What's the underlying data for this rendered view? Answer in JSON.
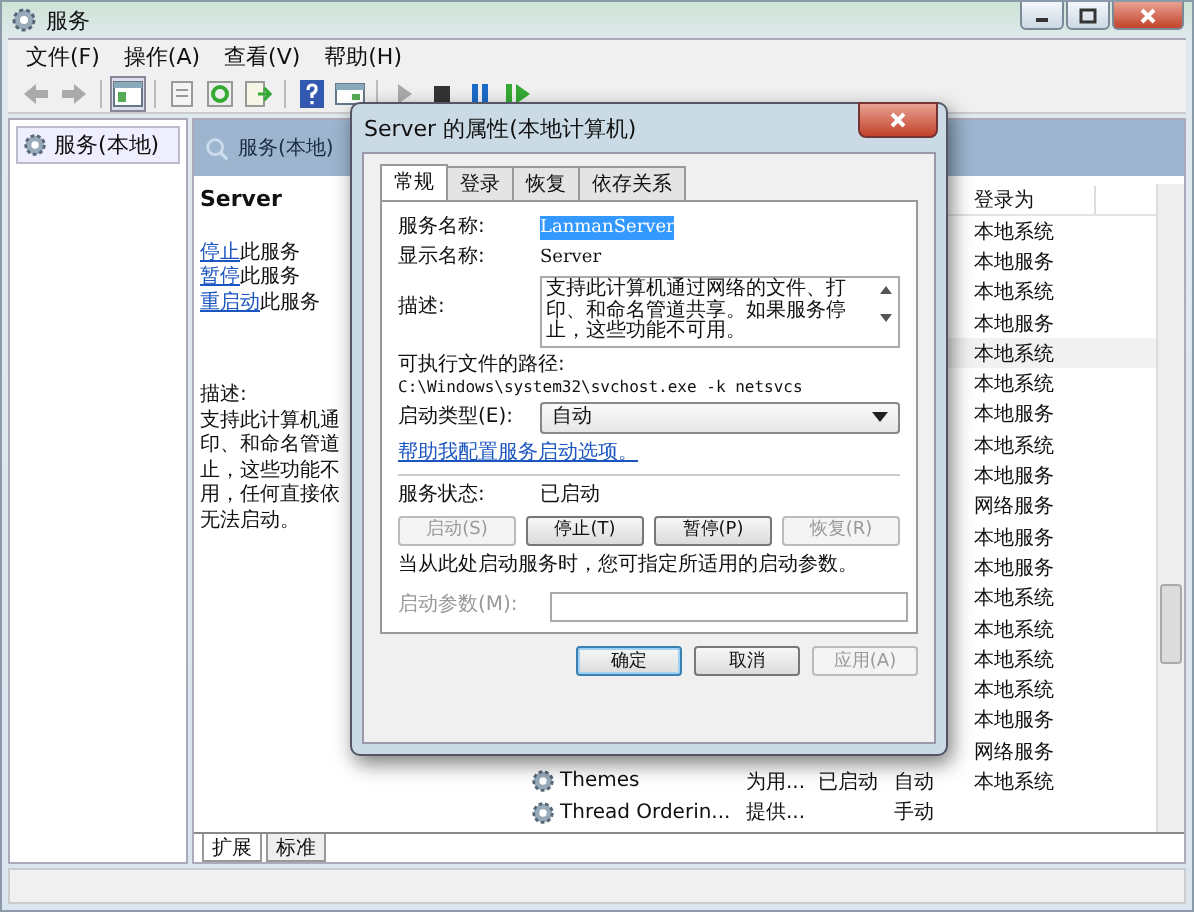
{
  "window": {
    "title": "服务"
  },
  "menu": [
    "文件(F)",
    "操作(A)",
    "查看(V)",
    "帮助(H)"
  ],
  "tree": {
    "items": [
      {
        "label": "服务(本地)",
        "selected": true
      }
    ]
  },
  "panel": {
    "header": "服务(本地)",
    "service": "Server",
    "actions": [
      {
        "link": "停止",
        "text": "此服务"
      },
      {
        "link": "暂停",
        "text": "此服务"
      },
      {
        "link": "重启动",
        "text": "此服务"
      }
    ],
    "description_label": "描述:",
    "description_lines": [
      "支持此计算机通",
      "印、和命名管道",
      "止，这些功能不",
      "用，任何直接依",
      "无法启动。"
    ]
  },
  "list": {
    "columns": [
      "登录为"
    ],
    "rows": [
      {
        "login": "本地系统"
      },
      {
        "login": "本地服务"
      },
      {
        "login": "本地系统"
      },
      {
        "login": "本地服务"
      },
      {
        "login": "本地系统",
        "selected": true
      },
      {
        "login": "本地系统"
      },
      {
        "login": "本地服务"
      },
      {
        "login": "本地系统"
      },
      {
        "login": "本地服务"
      },
      {
        "login": "网络服务"
      },
      {
        "login": "本地服务"
      },
      {
        "login": "本地服务"
      },
      {
        "login": "本地系统"
      },
      {
        "login": "本地系统"
      },
      {
        "login": "本地系统"
      },
      {
        "login": "本地系统"
      },
      {
        "login": "本地服务"
      },
      {
        "login": "网络服务"
      },
      {
        "name": "Themes",
        "description": "为用...",
        "status": "已启动",
        "startup": "自动",
        "login": "本地系统"
      },
      {
        "name": "Thread Orderin...",
        "description": "提供...",
        "startup": "手动"
      }
    ]
  },
  "view_tabs": [
    {
      "label": "扩展",
      "selected": true
    },
    {
      "label": "标准",
      "selected": false
    }
  ],
  "dialog": {
    "title": "Server 的属性(本地计算机)",
    "tabs": [
      {
        "label": "常规",
        "selected": true
      },
      {
        "label": "登录",
        "selected": false
      },
      {
        "label": "恢复",
        "selected": false
      },
      {
        "label": "依存关系",
        "selected": false
      }
    ],
    "service_name_label": "服务名称:",
    "service_name": "LanmanServer",
    "service_name_highlighted": true,
    "display_name_label": "显示名称:",
    "display_name": "Server",
    "description_label": "描述:",
    "description": "支持此计算机通过网络的文件、打印、和命名管道共享。如果服务停止，这些功能不可用。",
    "path_label": "可执行文件的路径:",
    "path": "C:\\Windows\\system32\\svchost.exe -k netsvcs",
    "startup_label": "启动类型(E):",
    "startup_value": "自动",
    "help_link": "帮助我配置服务启动选项。",
    "status_label": "服务状态:",
    "status_value": "已启动",
    "service_buttons": [
      {
        "label": "启动(S)",
        "disabled": true
      },
      {
        "label": "停止(T)",
        "disabled": false
      },
      {
        "label": "暂停(P)",
        "disabled": false
      },
      {
        "label": "恢复(R)",
        "disabled": true
      }
    ],
    "hint": "当从此处启动服务时，您可指定所适用的启动参数。",
    "params_label": "启动参数(M):",
    "params_disabled": true,
    "buttons": [
      {
        "label": "确定",
        "disabled": false,
        "default": true
      },
      {
        "label": "取消",
        "disabled": false,
        "default": false
      },
      {
        "label": "应用(A)",
        "disabled": true,
        "default": false
      }
    ]
  }
}
